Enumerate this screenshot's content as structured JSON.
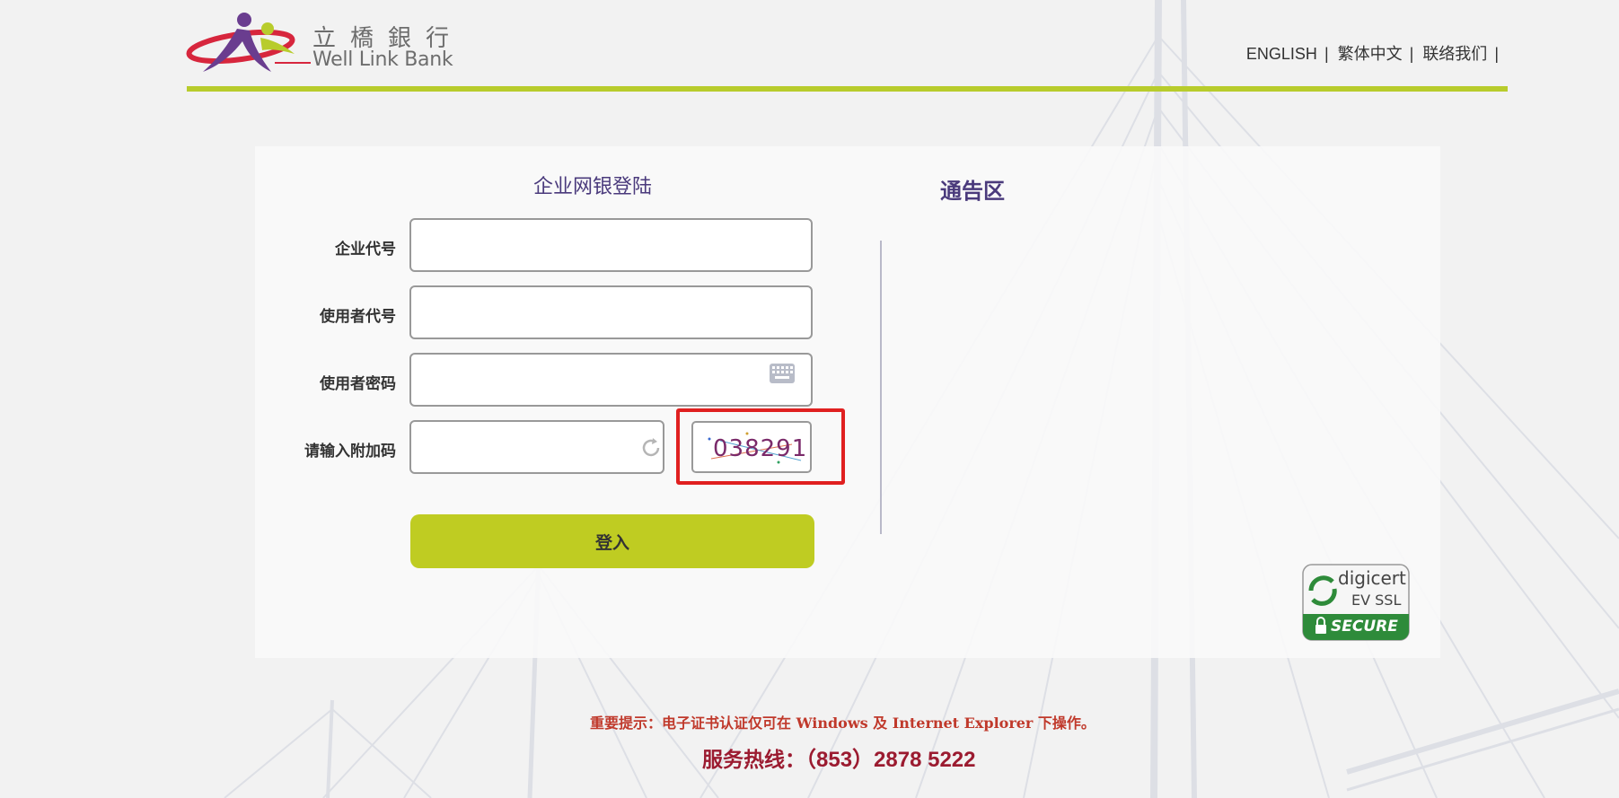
{
  "header": {
    "logo_cn": "立橋銀行",
    "logo_en": "Well Link Bank",
    "nav": [
      {
        "label": "ENGLISH"
      },
      {
        "label": "繁体中文"
      },
      {
        "label": "联络我们"
      }
    ],
    "separator": "|"
  },
  "login": {
    "title": "企业网银登陆",
    "fields": [
      {
        "label": "企业代号",
        "value": ""
      },
      {
        "label": "使用者代号",
        "value": ""
      },
      {
        "label": "使用者密码",
        "value": ""
      },
      {
        "label": "请输入附加码",
        "value": ""
      }
    ],
    "captcha_text": "038291",
    "submit_label": "登入"
  },
  "notice": {
    "title": "通告区"
  },
  "badge": {
    "line1": "digicert",
    "line2": "EV SSL",
    "line3": "SECURE"
  },
  "footer": {
    "important_note": "重要提示：电子证书认证仅可在 Windows 及 Internet Explorer 下操作。",
    "hotline_label": "服务热线：",
    "hotline_number": "（853）2878 5222"
  },
  "colors": {
    "accent_green": "#b8cc2c",
    "title_purple": "#4a3a7c",
    "alert_red": "#c0392b",
    "hotline_red": "#9b1b30"
  },
  "icons": [
    "keyboard-icon",
    "refresh-icon",
    "lock-icon"
  ]
}
